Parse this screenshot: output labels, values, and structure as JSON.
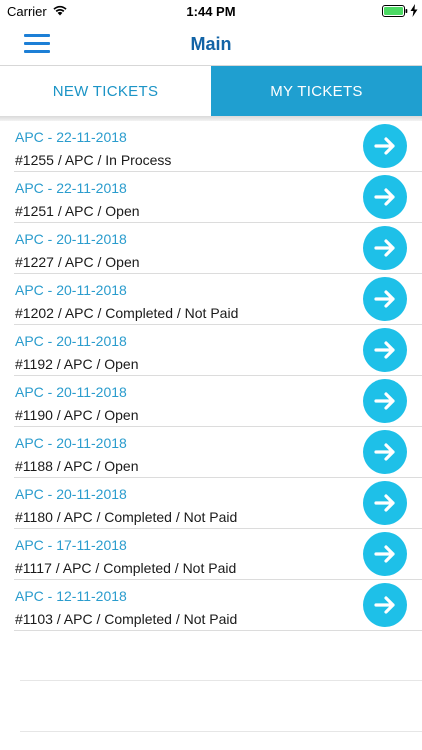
{
  "status_bar": {
    "carrier": "Carrier",
    "time": "1:44 PM",
    "battery_color": "#4cd964"
  },
  "nav": {
    "title": "Main",
    "menu_icon": "hamburger-menu-icon",
    "title_color": "#1263a6"
  },
  "tabs": [
    {
      "label": "NEW TICKETS",
      "selected": false
    },
    {
      "label": "MY TICKETS",
      "selected": true
    }
  ],
  "colors": {
    "accent": "#1f9fd0",
    "arrow_button": "#1ec0e8",
    "date_text": "#2a9ccd"
  },
  "tickets": [
    {
      "date": "APC - 22-11-2018",
      "info": "#1255 / APC / In Process"
    },
    {
      "date": "APC - 22-11-2018",
      "info": "#1251 / APC / Open"
    },
    {
      "date": "APC - 20-11-2018",
      "info": "#1227 / APC / Open"
    },
    {
      "date": "APC - 20-11-2018",
      "info": "#1202 / APC / Completed / Not Paid"
    },
    {
      "date": "APC - 20-11-2018",
      "info": "#1192 / APC / Open"
    },
    {
      "date": "APC - 20-11-2018",
      "info": "#1190 / APC / Open"
    },
    {
      "date": "APC - 20-11-2018",
      "info": "#1188 / APC / Open"
    },
    {
      "date": "APC - 20-11-2018",
      "info": "#1180 / APC / Completed / Not Paid"
    },
    {
      "date": "APC - 17-11-2018",
      "info": "#1117 / APC / Completed / Not Paid"
    },
    {
      "date": "APC - 12-11-2018",
      "info": "#1103 / APC / Completed / Not Paid"
    }
  ]
}
